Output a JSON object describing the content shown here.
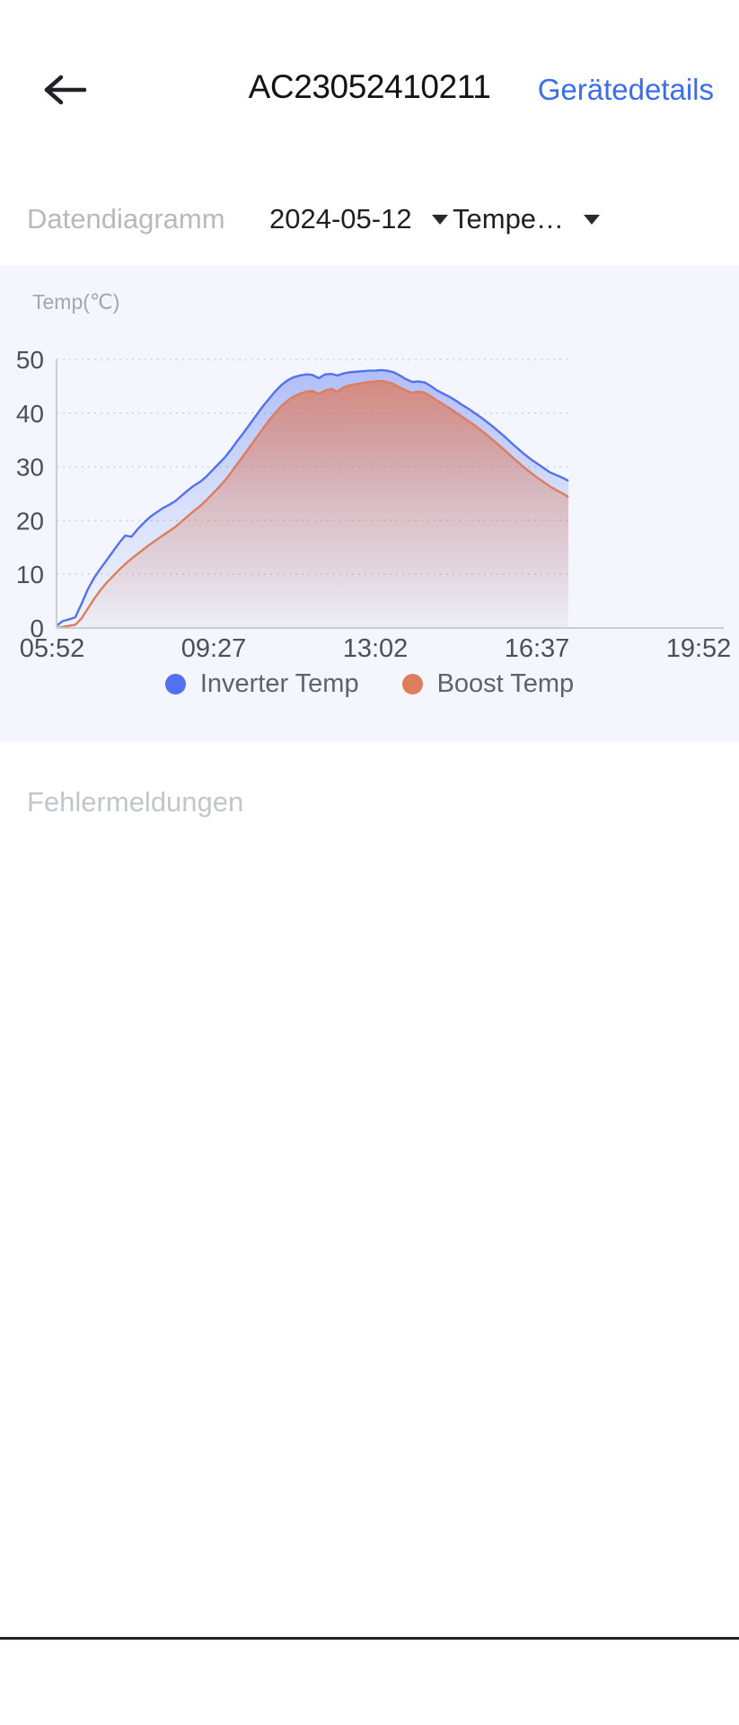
{
  "header": {
    "back_icon": "arrow-left-icon",
    "title": "AC23052410211",
    "details_link": "Gerätedetails",
    "link_color": "#3b6df0"
  },
  "filter": {
    "label": "Datendiagramm",
    "date_value": "2024-05-12",
    "date_caret_icon": "chevron-down-icon",
    "metric_value": "Tempe…",
    "metric_caret_icon": "chevron-down-icon"
  },
  "errors": {
    "title": "Fehlermeldungen"
  },
  "chart_data": {
    "type": "area",
    "title": "",
    "ylabel": "Temp(℃)",
    "xlabel": "",
    "ylim": [
      0,
      50
    ],
    "yticks": [
      0,
      10,
      20,
      30,
      40,
      50
    ],
    "xtick_labels": [
      "05:52",
      "09:27",
      "13:02",
      "16:37",
      "19:52"
    ],
    "grid": true,
    "legend_position": "bottom",
    "colors": {
      "inverter": "#5470f0",
      "boost": "#de7c5e",
      "panel_bg": "#f3f7fd",
      "grid": "#cfd4da",
      "axis": "#c9ced4"
    },
    "series": [
      {
        "name": "Inverter Temp",
        "color": "#5470f0",
        "values": [
          0.4,
          1.3,
          1.6,
          2.0,
          4.5,
          7.2,
          9.3,
          11.0,
          12.6,
          14.2,
          15.8,
          17.2,
          17.0,
          18.4,
          19.6,
          20.7,
          21.5,
          22.3,
          22.9,
          23.6,
          24.6,
          25.6,
          26.5,
          27.2,
          28.2,
          29.4,
          30.6,
          31.8,
          33.3,
          34.9,
          36.4,
          38.0,
          39.6,
          41.2,
          42.6,
          44.0,
          45.2,
          46.1,
          46.7,
          47.0,
          47.2,
          47.1,
          46.5,
          47.2,
          47.3,
          47.0,
          47.4,
          47.6,
          47.7,
          47.8,
          47.9,
          47.9,
          48.0,
          47.9,
          47.6,
          47.0,
          46.3,
          45.8,
          45.9,
          45.7,
          45.0,
          44.2,
          43.6,
          43.0,
          42.3,
          41.5,
          40.8,
          40.0,
          39.2,
          38.3,
          37.4,
          36.4,
          35.4,
          34.3,
          33.3,
          32.3,
          31.4,
          30.6,
          29.8,
          29.0,
          28.5,
          28.0,
          27.4
        ]
      },
      {
        "name": "Boost Temp",
        "color": "#de7c5e",
        "values": [
          0.0,
          0.2,
          0.4,
          0.6,
          1.8,
          3.6,
          5.4,
          7.0,
          8.4,
          9.6,
          10.8,
          11.9,
          12.9,
          13.8,
          14.7,
          15.6,
          16.4,
          17.2,
          18.0,
          18.8,
          19.8,
          20.8,
          21.8,
          22.7,
          23.8,
          25.0,
          26.2,
          27.5,
          29.0,
          30.6,
          32.2,
          33.8,
          35.4,
          37.0,
          38.6,
          40.0,
          41.3,
          42.3,
          43.1,
          43.6,
          44.0,
          44.1,
          43.6,
          44.2,
          44.5,
          44.0,
          44.8,
          45.2,
          45.4,
          45.6,
          45.8,
          45.9,
          46.0,
          45.8,
          45.4,
          44.8,
          44.2,
          43.8,
          44.0,
          43.8,
          43.1,
          42.3,
          41.6,
          40.9,
          40.1,
          39.3,
          38.5,
          37.7,
          36.8,
          35.9,
          34.9,
          33.9,
          32.9,
          31.8,
          30.8,
          29.8,
          28.9,
          28.0,
          27.2,
          26.4,
          25.7,
          25.1,
          24.4
        ]
      }
    ]
  }
}
